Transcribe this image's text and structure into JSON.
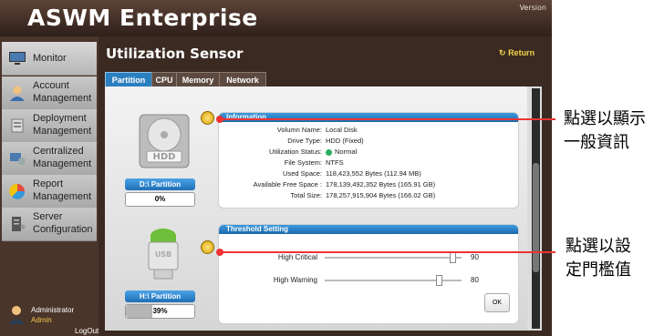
{
  "app": {
    "brand": "ASWM Enterprise",
    "version": "Version"
  },
  "sidebar": {
    "items": [
      {
        "label": "Monitor",
        "icon": "monitor-icon"
      },
      {
        "label": "Account\nManagement",
        "icon": "account-icon"
      },
      {
        "label": "Deployment\nManagement",
        "icon": "deployment-icon"
      },
      {
        "label": "Centralized\nManagement",
        "icon": "centralized-icon"
      },
      {
        "label": "Report\nManagement",
        "icon": "report-icon"
      },
      {
        "label": "Server\nConfiguration",
        "icon": "server-icon"
      }
    ],
    "user": {
      "name": "Administrator",
      "role": "Admin"
    },
    "logout": "LogOut"
  },
  "main": {
    "title": "Utilization Sensor",
    "return_label": "Return",
    "tabs": [
      "Partition",
      "CPU",
      "Memory",
      "Network"
    ],
    "active_tab": "Partition"
  },
  "drives": [
    {
      "label": "D:\\ Partition",
      "percent": "0%",
      "usage_fraction": 0.0
    },
    {
      "label": "H:\\ Partition",
      "percent": "39%",
      "usage_fraction": 0.39
    }
  ],
  "information": {
    "title": "Information",
    "rows": [
      {
        "key": "Volumn Name:",
        "value": "Local Disk"
      },
      {
        "key": "Drive Type:",
        "value": "HDD (Fixed)"
      },
      {
        "key": "Utilization Status:",
        "value": "Normal"
      },
      {
        "key": "File System:",
        "value": "NTFS"
      },
      {
        "key": "Used Space:",
        "value": "118,423,552 Bytes (112.94 MB)"
      },
      {
        "key": "Available Free Space :",
        "value": "178,139,492,352 Bytes (165.91 GB)"
      },
      {
        "key": "Total Size:",
        "value": "178,257,915,904 Bytes (166.02 GB)"
      }
    ]
  },
  "threshold": {
    "title": "Threshold Setting",
    "high_critical_label": "High Critical",
    "high_critical_value": "90",
    "high_warning_label": "High Warning",
    "high_warning_value": "80",
    "ok_label": "OK"
  },
  "callouts": {
    "info": "點選以顯示\n一般資訊",
    "threshold": "點選以設\n定門檻值"
  },
  "colors": {
    "accent": "#2a7fc0",
    "callout": "#e33333",
    "status_normal": "#27ae60"
  }
}
